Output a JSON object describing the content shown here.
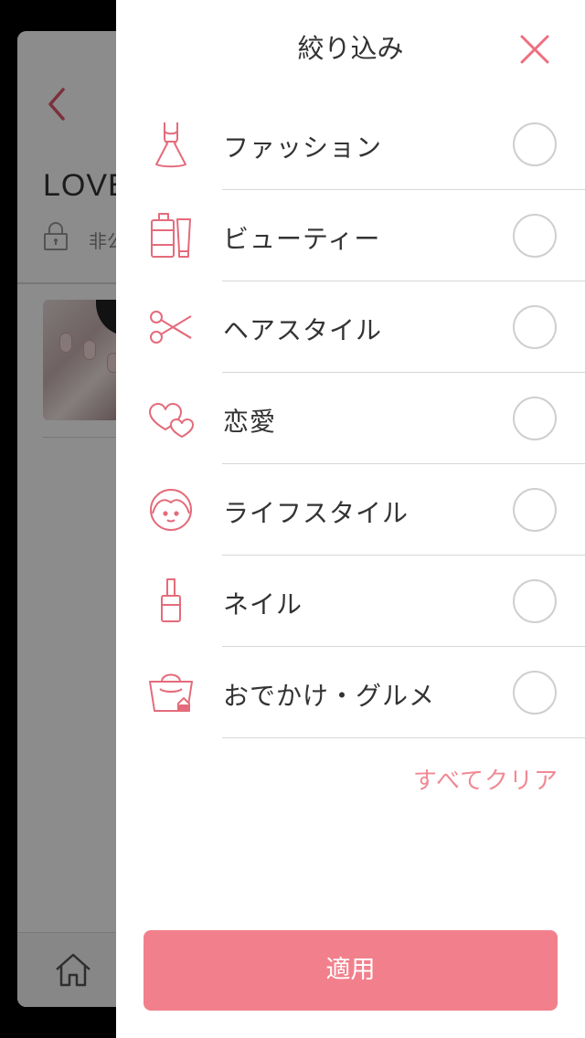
{
  "background": {
    "title": "LOVE",
    "privacy": "非公"
  },
  "panel": {
    "title": "絞り込み",
    "accent": "#f2808c",
    "categories": [
      {
        "label": "ファッション",
        "icon": "dress-icon",
        "selected": false
      },
      {
        "label": "ビューティー",
        "icon": "cosmetics-icon",
        "selected": false
      },
      {
        "label": "ヘアスタイル",
        "icon": "scissors-icon",
        "selected": false
      },
      {
        "label": "恋愛",
        "icon": "hearts-icon",
        "selected": false
      },
      {
        "label": "ライフスタイル",
        "icon": "girl-face-icon",
        "selected": false
      },
      {
        "label": "ネイル",
        "icon": "nail-polish-icon",
        "selected": false
      },
      {
        "label": "おでかけ・グルメ",
        "icon": "bag-icon",
        "selected": false
      }
    ],
    "clear_all": "すべてクリア",
    "apply": "適用"
  }
}
